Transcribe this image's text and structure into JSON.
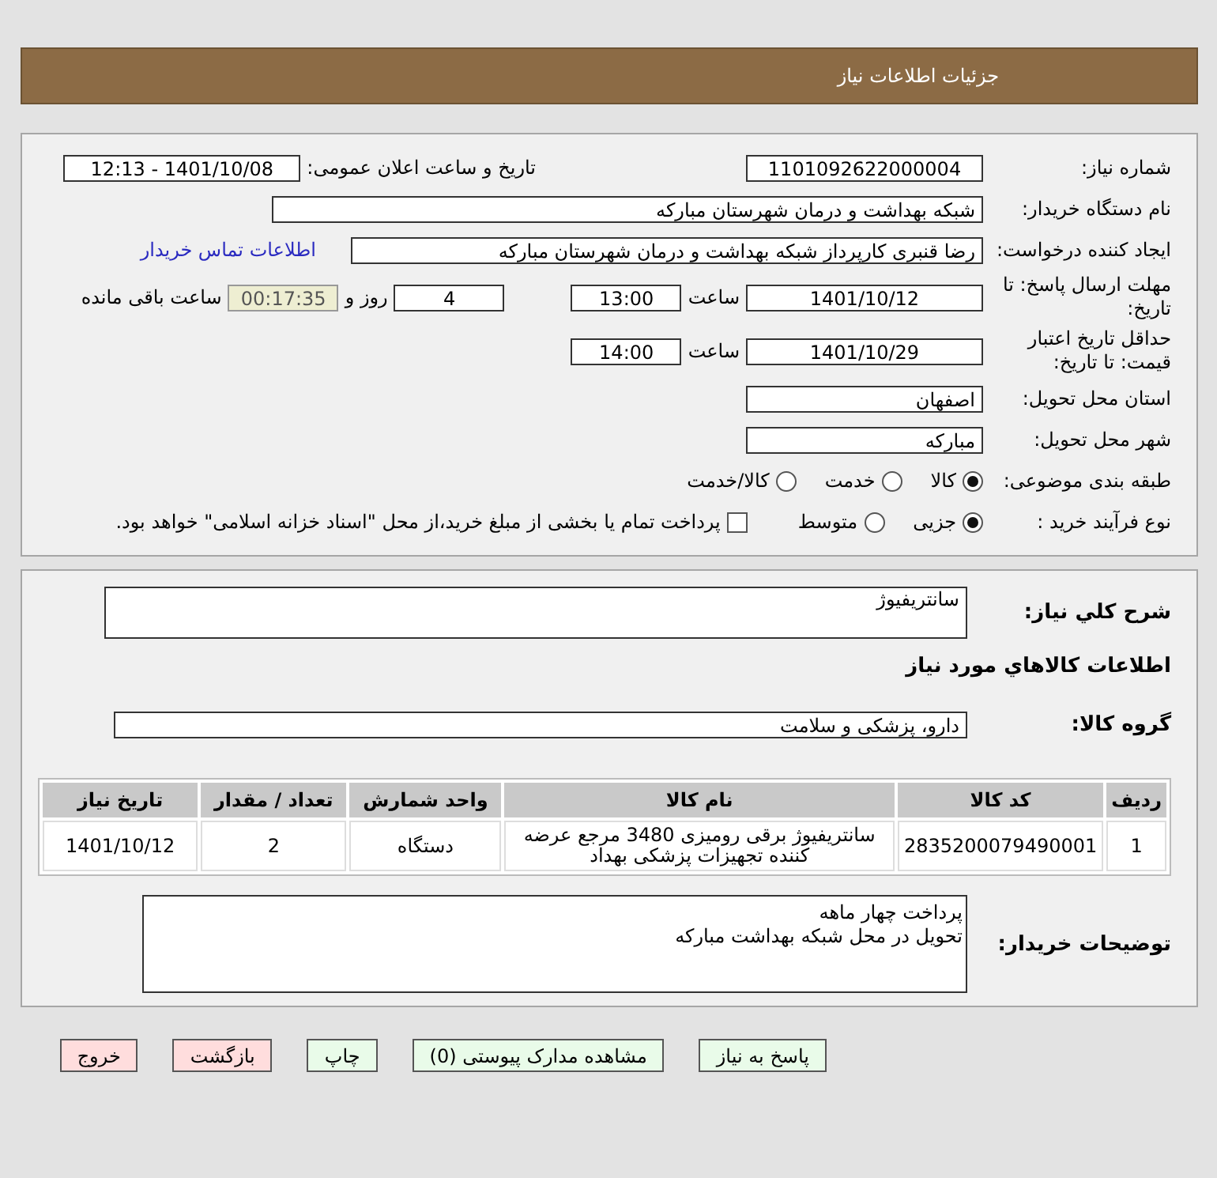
{
  "header": {
    "title": "جزئیات اطلاعات نیاز"
  },
  "details": {
    "need_number": {
      "label": "شماره نیاز:",
      "value": "1101092622000004"
    },
    "announce": {
      "label": "تاریخ و ساعت اعلان عمومی:",
      "value": "1401/10/08 - 12:13"
    },
    "buyer": {
      "label": "نام دستگاه خریدار:",
      "value": "شبکه بهداشت و درمان شهرستان مبارکه"
    },
    "creator": {
      "label": "ایجاد کننده درخواست:",
      "value": "رضا قنبری کارپرداز شبکه بهداشت و درمان شهرستان مبارکه",
      "link": "اطلاعات تماس خریدار"
    },
    "deadline": {
      "label": "مهلت ارسال پاسخ: تا تاریخ:",
      "date": "1401/10/12",
      "time_label": "ساعت",
      "time": "13:00",
      "days": "4",
      "days_label": "روز و",
      "remaining": "00:17:35",
      "remaining_label": "ساعت باقی مانده"
    },
    "validity": {
      "label": "حداقل تاریخ اعتبار قیمت: تا تاریخ:",
      "date": "1401/10/29",
      "time_label": "ساعت",
      "time": "14:00"
    },
    "province": {
      "label": "استان محل تحویل:",
      "value": "اصفهان"
    },
    "city": {
      "label": "شهر محل تحویل:",
      "value": "مبارکه"
    },
    "category": {
      "label": "طبقه بندی موضوعی:",
      "options": [
        {
          "label": "کالا",
          "selected": true
        },
        {
          "label": "خدمت",
          "selected": false
        },
        {
          "label": "کالا/خدمت",
          "selected": false
        }
      ]
    },
    "process": {
      "label": "نوع فرآیند خرید :",
      "options": [
        {
          "label": "جزیی",
          "selected": true
        },
        {
          "label": "متوسط",
          "selected": false
        }
      ],
      "treasury": {
        "label": "پرداخت تمام یا بخشی از مبلغ خرید،از محل \"اسناد خزانه اسلامی\" خواهد بود.",
        "checked": false
      }
    }
  },
  "need": {
    "summary": {
      "label": "شرح کلي نياز:",
      "value": "سانتریفیوژ"
    },
    "goods_title": "اطلاعات كالاهاي مورد نياز",
    "group": {
      "label": "گروه کالا:",
      "value": "دارو، پزشکی و سلامت"
    },
    "table": {
      "columns": [
        "ردیف",
        "کد کالا",
        "نام کالا",
        "واحد شمارش",
        "تعداد / مقدار",
        "تاریخ نیاز"
      ],
      "rows": [
        [
          "1",
          "2835200079490001",
          "سانتریفیوژ برقی رومیزی 3480 مرجع عرضه کننده تجهیزات پزشکی بهداد",
          "دستگاه",
          "2",
          "1401/10/12"
        ]
      ]
    },
    "notes": {
      "label": "توضیحات خریدار:",
      "lines": [
        "پرداخت چهار ماهه",
        "تحویل در محل شبکه بهداشت مبارکه"
      ]
    }
  },
  "buttons": [
    {
      "label": "پاسخ به نیاز",
      "kind": "normal"
    },
    {
      "label": "مشاهده مدارک پیوستی (0)",
      "kind": "normal"
    },
    {
      "label": "چاپ",
      "kind": "normal"
    },
    {
      "label": "بازگشت",
      "kind": "danger"
    },
    {
      "label": "خروج",
      "kind": "danger"
    }
  ]
}
